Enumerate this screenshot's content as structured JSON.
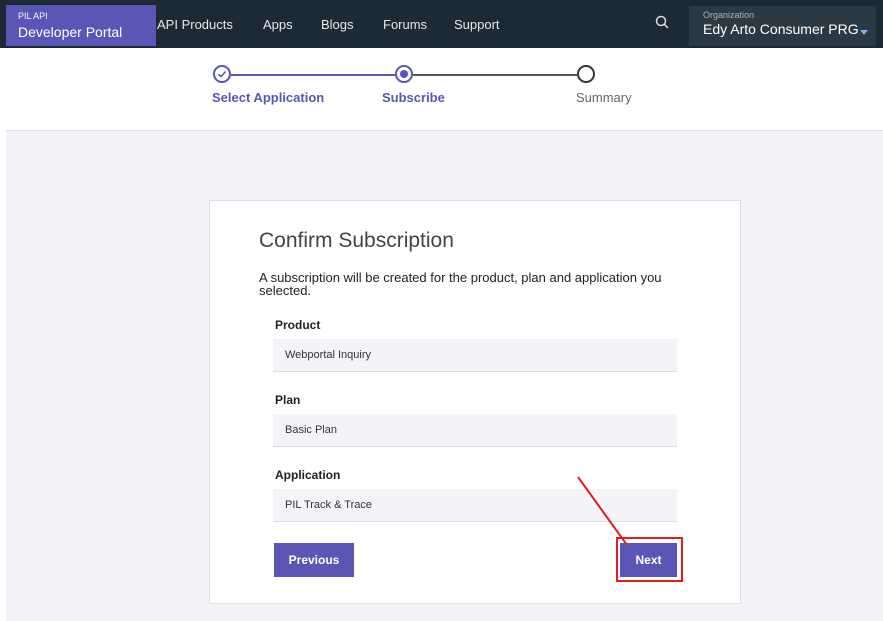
{
  "nav": {
    "brand_small": "PIL API",
    "brand_main": "Developer Portal",
    "items": [
      "API Products",
      "Apps",
      "Blogs",
      "Forums",
      "Support"
    ],
    "org_label": "Organization",
    "org_name": "Edy Arto Consumer PRG",
    "search_icon": "search-icon"
  },
  "stepper": {
    "steps": [
      {
        "label": "Select Application",
        "state": "completed"
      },
      {
        "label": "Subscribe",
        "state": "current"
      },
      {
        "label": "Summary",
        "state": "upcoming"
      }
    ]
  },
  "card": {
    "title": "Confirm Subscription",
    "description": "A subscription will be created for the product, plan and application you selected.",
    "fields": [
      {
        "label": "Product",
        "value": "Webportal Inquiry"
      },
      {
        "label": "Plan",
        "value": "Basic Plan"
      },
      {
        "label": "Application",
        "value": "PIL Track & Trace"
      }
    ],
    "previous_label": "Previous",
    "next_label": "Next"
  },
  "colors": {
    "accent": "#5a56b5",
    "nav_bg": "#1c2a36",
    "highlight": "#e01e1e"
  }
}
